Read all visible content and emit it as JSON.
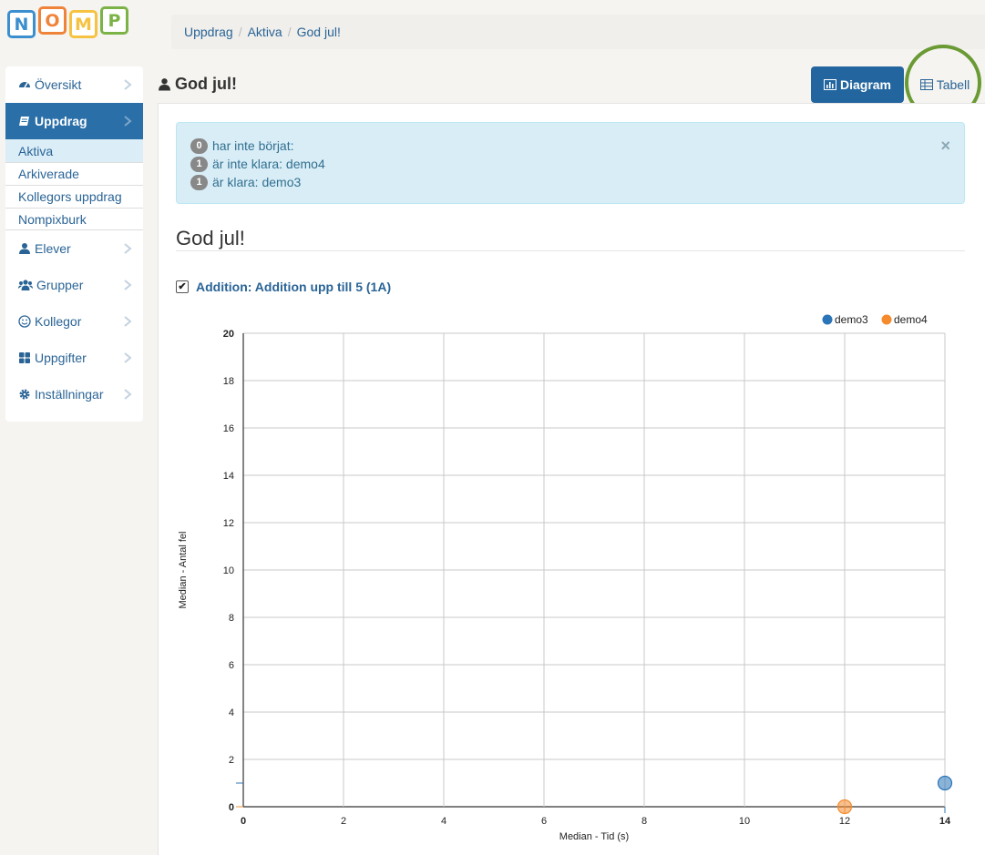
{
  "logo": {
    "letters": [
      "N",
      "O",
      "M",
      "P"
    ],
    "colors": [
      "#3b8fce",
      "#f0833a",
      "#f6c241",
      "#7cb347"
    ]
  },
  "breadcrumb": [
    "Uppdrag",
    "Aktiva",
    "God jul!"
  ],
  "sidebar": {
    "items": [
      {
        "label": "Översikt",
        "icon": "dashboard-icon"
      },
      {
        "label": "Uppdrag",
        "icon": "book-icon",
        "active": true
      },
      {
        "label": "Elever",
        "icon": "user-icon"
      },
      {
        "label": "Grupper",
        "icon": "users-icon"
      },
      {
        "label": "Kollegor",
        "icon": "smile-icon"
      },
      {
        "label": "Uppgifter",
        "icon": "grid-icon"
      },
      {
        "label": "Inställningar",
        "icon": "gear-icon"
      }
    ],
    "subitems": [
      "Aktiva",
      "Arkiverade",
      "Kollegors uppdrag",
      "Nompixburk"
    ]
  },
  "header": {
    "title": "God jul!",
    "diagram_label": "Diagram",
    "tabell_label": "Tabell"
  },
  "alert": {
    "rows": [
      {
        "count": "0",
        "text": "har inte börjat:"
      },
      {
        "count": "1",
        "text": "är inte klara: demo4"
      },
      {
        "count": "1",
        "text": "är klara: demo3"
      }
    ],
    "close": "×"
  },
  "section_title": "God jul!",
  "task": {
    "checked": "✔",
    "label": "Addition: Addition upp till 5 (1A)"
  },
  "colors": {
    "primary": "#23669f",
    "demo3": "#2a74b8",
    "demo4": "#f58b2c",
    "highlight": "#6a9a34"
  },
  "chart_data": {
    "type": "scatter",
    "xlabel": "Median - Tid (s)",
    "ylabel": "Median - Antal fel",
    "xlim": [
      0,
      14
    ],
    "ylim": [
      0,
      20
    ],
    "xticks": [
      0,
      2,
      4,
      6,
      8,
      10,
      12,
      14
    ],
    "yticks": [
      0,
      2,
      4,
      6,
      8,
      10,
      12,
      14,
      16,
      18,
      20
    ],
    "grid": true,
    "legend_position": "top-right",
    "series": [
      {
        "name": "demo3",
        "color": "#2a74b8",
        "points": [
          {
            "x": 14,
            "y": 1
          }
        ]
      },
      {
        "name": "demo4",
        "color": "#f58b2c",
        "points": [
          {
            "x": 12,
            "y": 0
          }
        ]
      }
    ]
  }
}
